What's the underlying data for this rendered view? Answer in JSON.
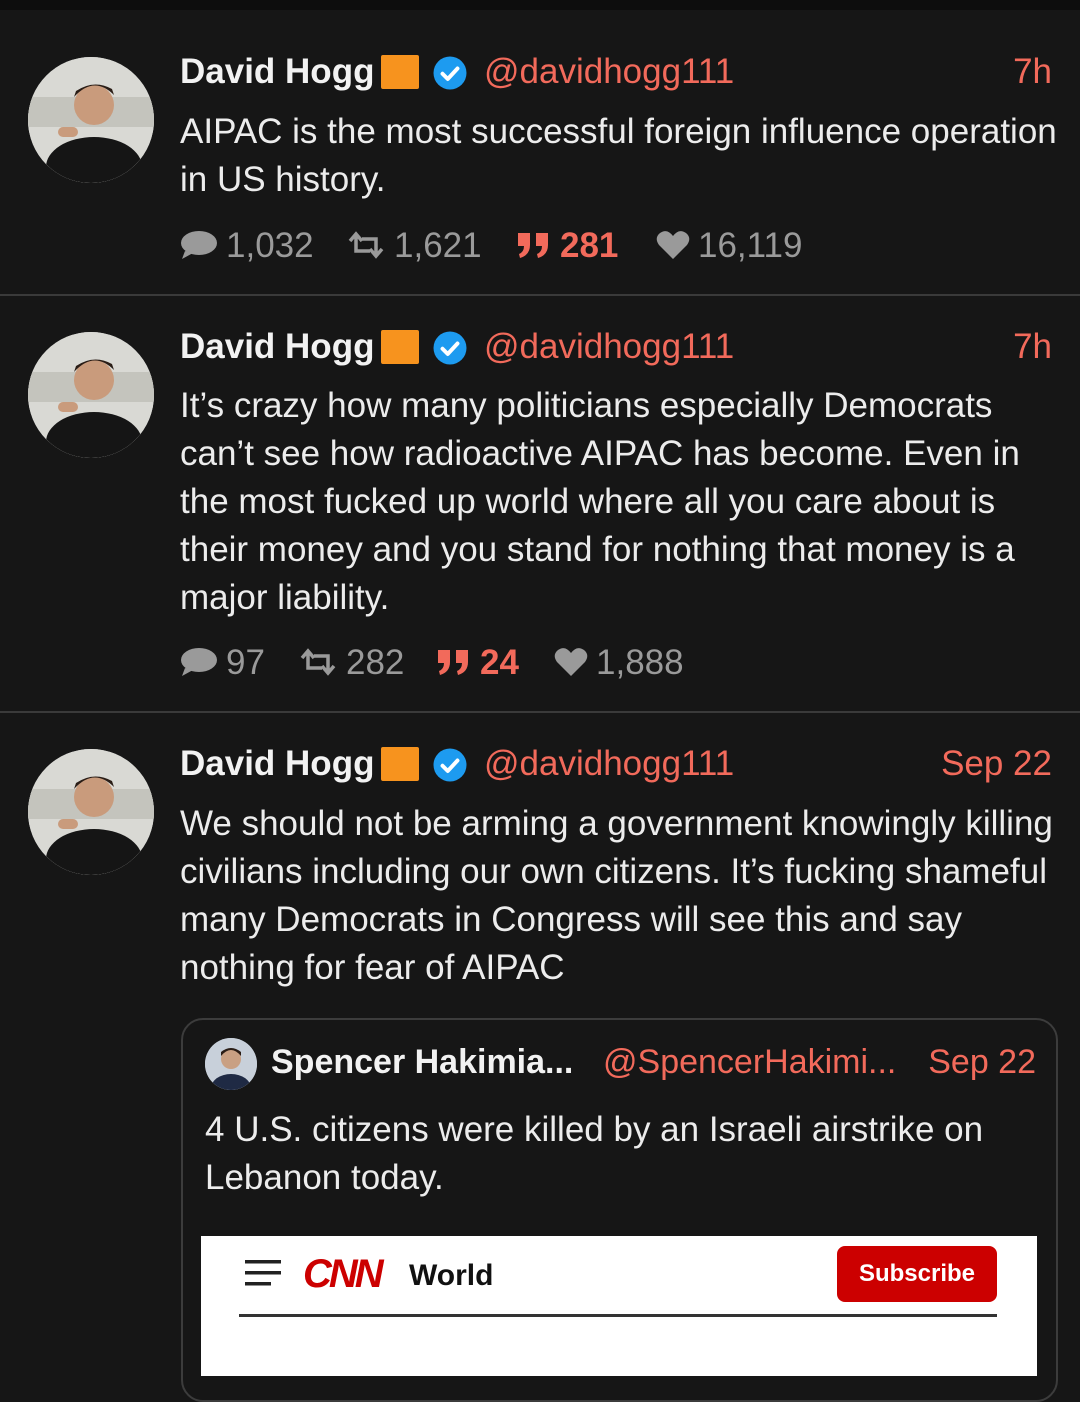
{
  "colors": {
    "background": "#161616",
    "accent": "#f26a5b",
    "muted": "#9a9a9a",
    "badge_square": "#f7931e",
    "verified": "#1d9bf0"
  },
  "tweets": [
    {
      "name": "David Hogg",
      "handle": "@davidhogg111",
      "time": "7h",
      "text": "AIPAC is the most successful foreign influence operation in US history.",
      "replies": "1,032",
      "retweets": "1,621",
      "quotes": "281",
      "likes": "16,119"
    },
    {
      "name": "David Hogg",
      "handle": "@davidhogg111",
      "time": "7h",
      "text": "It’s crazy how many politicians especially Democrats can’t see how radioactive AIPAC has become. Even in the most fucked up world where all you care about is their money and you stand for nothing that money is a major liability.",
      "replies": "97",
      "retweets": "282",
      "quotes": "24",
      "likes": "1,888"
    },
    {
      "name": "David Hogg",
      "handle": "@davidhogg111",
      "time": "Sep 22",
      "text": "We should not be arming a government knowingly killing civilians including our own citizens. It’s fucking shameful many Democrats in Congress will see this and say nothing for fear of AIPAC"
    }
  ],
  "quoted": {
    "name": "Spencer Hakimia...",
    "handle": "@SpencerHakimi...",
    "time": "Sep 22",
    "text": "4 U.S. citizens were killed by an Israeli airstrike on Lebanon today.",
    "media": {
      "logo": "CNN",
      "section": "World",
      "subscribe": "Subscribe"
    }
  }
}
